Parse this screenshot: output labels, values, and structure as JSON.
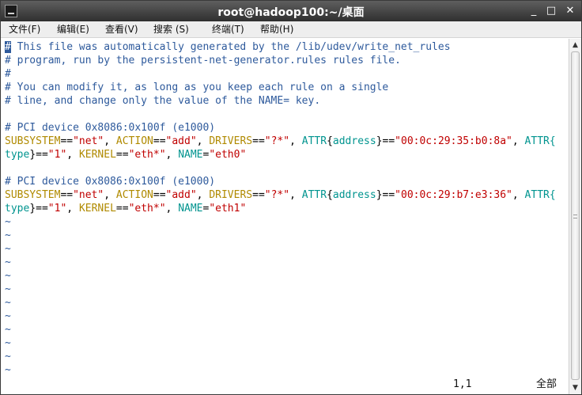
{
  "window": {
    "title": "root@hadoop100:~/桌面",
    "buttons": {
      "minimize": "_",
      "maximize": "□",
      "close": "✕"
    }
  },
  "menu": [
    {
      "label": "文件(F)"
    },
    {
      "label": "编辑(E)"
    },
    {
      "label": "查看(V)"
    },
    {
      "label": "搜索 (S)"
    },
    {
      "label": "终端(T)"
    },
    {
      "label": "帮助(H)"
    }
  ],
  "editor": {
    "cursor_char": "#",
    "lines": [
      [
        {
          "t": "# This file was automatically generated by the /lib/udev/write_net_rules",
          "c": "comment"
        }
      ],
      [
        {
          "t": "# program, run by the persistent-net-generator.rules rules file.",
          "c": "comment"
        }
      ],
      [
        {
          "t": "#",
          "c": "comment"
        }
      ],
      [
        {
          "t": "# You can modify it, as long as you keep each rule on a single",
          "c": "comment"
        }
      ],
      [
        {
          "t": "# line, and change only the value of the NAME= key.",
          "c": "comment"
        }
      ],
      [
        {
          "t": "",
          "c": "plain"
        }
      ],
      [
        {
          "t": "# PCI device 0x8086:0x100f (e1000)",
          "c": "comment"
        }
      ],
      [
        {
          "t": "SUBSYSTEM",
          "c": "key"
        },
        {
          "t": "==",
          "c": "plain"
        },
        {
          "t": "\"net\"",
          "c": "str"
        },
        {
          "t": ", ",
          "c": "plain"
        },
        {
          "t": "ACTION",
          "c": "key"
        },
        {
          "t": "==",
          "c": "plain"
        },
        {
          "t": "\"add\"",
          "c": "str"
        },
        {
          "t": ", ",
          "c": "plain"
        },
        {
          "t": "DRIVERS",
          "c": "key"
        },
        {
          "t": "==",
          "c": "plain"
        },
        {
          "t": "\"?*\"",
          "c": "str"
        },
        {
          "t": ", ",
          "c": "plain"
        },
        {
          "t": "ATTR",
          "c": "attr"
        },
        {
          "t": "{",
          "c": "plain"
        },
        {
          "t": "address",
          "c": "attr"
        },
        {
          "t": "}==",
          "c": "plain"
        },
        {
          "t": "\"00:0c:29:35:b0:8a\"",
          "c": "str"
        },
        {
          "t": ", ",
          "c": "plain"
        },
        {
          "t": "ATTR{",
          "c": "attr"
        }
      ],
      [
        {
          "t": "type",
          "c": "attr"
        },
        {
          "t": "}==",
          "c": "plain"
        },
        {
          "t": "\"1\"",
          "c": "str"
        },
        {
          "t": ", ",
          "c": "plain"
        },
        {
          "t": "KERNEL",
          "c": "key"
        },
        {
          "t": "==",
          "c": "plain"
        },
        {
          "t": "\"eth*\"",
          "c": "str"
        },
        {
          "t": ", ",
          "c": "plain"
        },
        {
          "t": "NAME",
          "c": "attr"
        },
        {
          "t": "=",
          "c": "plain"
        },
        {
          "t": "\"eth0\"",
          "c": "str"
        }
      ],
      [
        {
          "t": "",
          "c": "plain"
        }
      ],
      [
        {
          "t": "# PCI device 0x8086:0x100f (e1000)",
          "c": "comment"
        }
      ],
      [
        {
          "t": "SUBSYSTEM",
          "c": "key"
        },
        {
          "t": "==",
          "c": "plain"
        },
        {
          "t": "\"net\"",
          "c": "str"
        },
        {
          "t": ", ",
          "c": "plain"
        },
        {
          "t": "ACTION",
          "c": "key"
        },
        {
          "t": "==",
          "c": "plain"
        },
        {
          "t": "\"add\"",
          "c": "str"
        },
        {
          "t": ", ",
          "c": "plain"
        },
        {
          "t": "DRIVERS",
          "c": "key"
        },
        {
          "t": "==",
          "c": "plain"
        },
        {
          "t": "\"?*\"",
          "c": "str"
        },
        {
          "t": ", ",
          "c": "plain"
        },
        {
          "t": "ATTR",
          "c": "attr"
        },
        {
          "t": "{",
          "c": "plain"
        },
        {
          "t": "address",
          "c": "attr"
        },
        {
          "t": "}==",
          "c": "plain"
        },
        {
          "t": "\"00:0c:29:b7:e3:36\"",
          "c": "str"
        },
        {
          "t": ", ",
          "c": "plain"
        },
        {
          "t": "ATTR{",
          "c": "attr"
        }
      ],
      [
        {
          "t": "type",
          "c": "attr"
        },
        {
          "t": "}==",
          "c": "plain"
        },
        {
          "t": "\"1\"",
          "c": "str"
        },
        {
          "t": ", ",
          "c": "plain"
        },
        {
          "t": "KERNEL",
          "c": "key"
        },
        {
          "t": "==",
          "c": "plain"
        },
        {
          "t": "\"eth*\"",
          "c": "str"
        },
        {
          "t": ", ",
          "c": "plain"
        },
        {
          "t": "NAME",
          "c": "attr"
        },
        {
          "t": "=",
          "c": "plain"
        },
        {
          "t": "\"eth1\"",
          "c": "str"
        }
      ]
    ],
    "tilde": "~",
    "tilde_count": 12
  },
  "status": {
    "position": "1,1",
    "scroll": "全部"
  },
  "colors": {
    "comment": "#2e5a9c",
    "keyword": "#b08a00",
    "string": "#c00000",
    "attribute": "#00948f"
  },
  "icons": {
    "app": "terminal-icon",
    "scroll_up": "arrow-up-icon",
    "scroll_down": "arrow-down-icon"
  }
}
